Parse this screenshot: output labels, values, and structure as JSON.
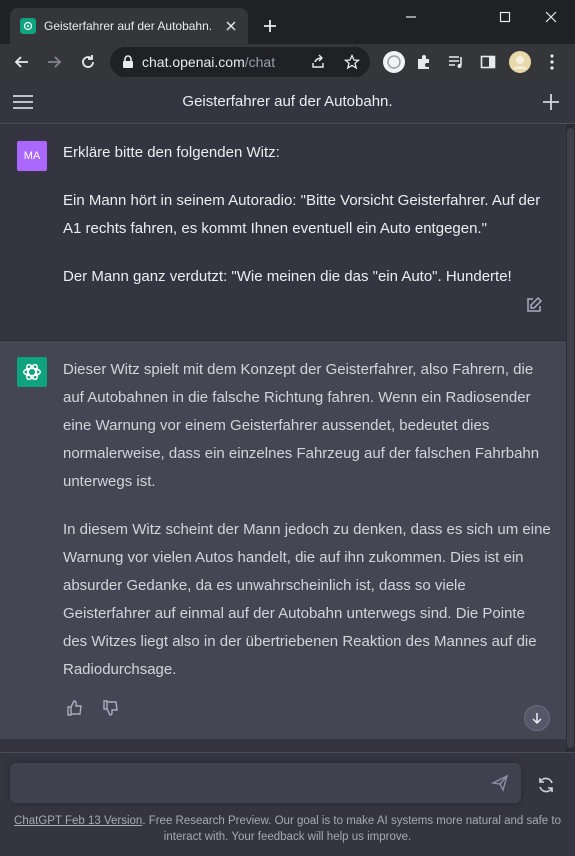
{
  "browser": {
    "tab_title": "Geisterfahrer auf der Autobahn.",
    "url_host": "chat.openai.com",
    "url_path": "/chat"
  },
  "header": {
    "title": "Geisterfahrer auf der Autobahn."
  },
  "user_message": {
    "avatar": "MA",
    "paragraphs": [
      "Erkläre bitte den folgenden Witz:",
      "Ein Mann hört in seinem Autoradio: \"Bitte Vorsicht Geisterfahrer. Auf der A1 rechts fahren, es kommt Ihnen eventuell ein Auto entgegen.\"",
      "Der Mann ganz verdutzt: \"Wie meinen die das \"ein Auto\". Hunderte!"
    ]
  },
  "assistant_message": {
    "paragraphs": [
      "Dieser Witz spielt mit dem Konzept der Geisterfahrer, also Fahrern, die auf Autobahnen in die falsche Richtung fahren. Wenn ein Radiosender eine Warnung vor einem Geisterfahrer aussendet, bedeutet dies normalerweise, dass ein einzelnes Fahrzeug auf der falschen Fahrbahn unterwegs ist.",
      "In diesem Witz scheint der Mann jedoch zu denken, dass es sich um eine Warnung vor vielen Autos handelt, die auf ihn zukommen. Dies ist ein absurder Gedanke, da es unwahrscheinlich ist, dass so viele Geisterfahrer auf einmal auf der Autobahn unterwegs sind. Die Pointe des Witzes liegt also in der übertriebenen Reaktion des Mannes auf die Radiodurchsage."
    ]
  },
  "composer": {
    "value": "",
    "placeholder": ""
  },
  "footer": {
    "link_text": "ChatGPT Feb 13 Version",
    "text": ". Free Research Preview. Our goal is to make AI systems more natural and safe to interact with. Your feedback will help us improve."
  },
  "colors": {
    "accent": "#10a37f",
    "user_avatar": "#ab68ff",
    "chat_bg": "#343541",
    "assistant_bg": "#444654"
  }
}
